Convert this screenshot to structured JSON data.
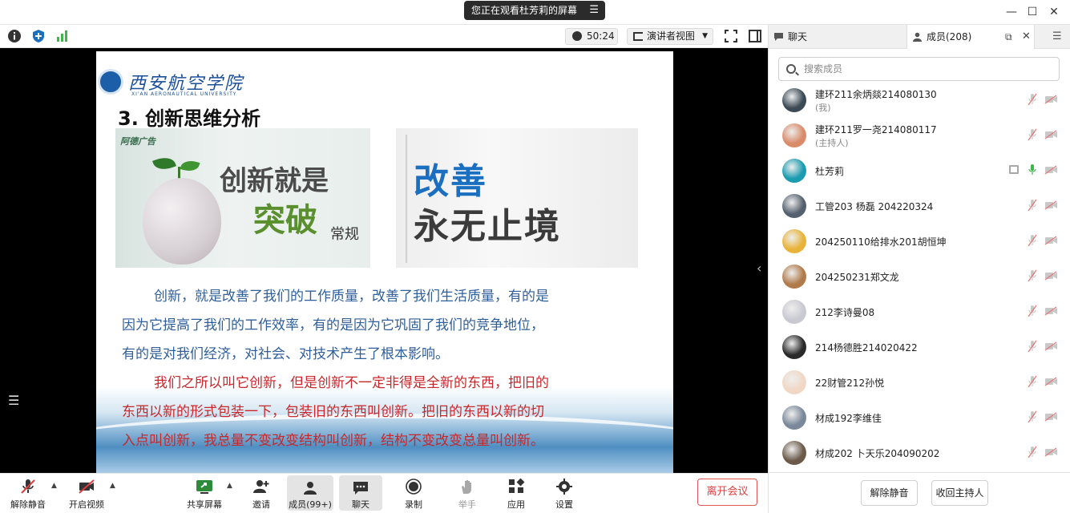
{
  "window": {
    "share_banner": "您正在观看杜芳莉的屏幕",
    "minimize": "—",
    "maximize": "☐",
    "close": "✕"
  },
  "toolbar": {
    "timer": "50:24",
    "view_mode": "演讲者视图"
  },
  "slide": {
    "logo_cn": "西安航空学院",
    "logo_en": "XI'AN AERONAUTICAL UNIVERSITY",
    "title": "3. 创新思维分析",
    "img_left_brand": "阿德广告",
    "img_left_t1": "创新就是",
    "img_left_t2": "突破",
    "img_left_t3": "常规",
    "img_right_line1": "改善",
    "img_right_line2": "永无止境",
    "para_blue": [
      "创新，就是改善了我们的工作质量，改善了我们生活质量，有的是",
      "因为它提高了我们的工作效率，有的是因为它巩固了我们的竞争地位，",
      "有的是对我们经济，对社会、对技术产生了根本影响。"
    ],
    "para_red": [
      "我们之所以叫它创新，但是创新不一定非得是全新的东西，把旧的",
      "东西以新的形式包装一下，包装旧的东西叫创新。把旧的东西以新的切",
      "入点叫创新，我总量不变改变结构叫创新，结构不变改变总量叫创新。"
    ]
  },
  "bottombar": {
    "unmute": "解除静音",
    "start_video": "开启视频",
    "share_screen": "共享屏幕",
    "invite": "邀请",
    "members": "成员(99+)",
    "chat": "聊天",
    "record": "录制",
    "raise_hand": "举手",
    "apps": "应用",
    "settings": "设置",
    "leave": "离开会议"
  },
  "panel": {
    "tab_chat": "聊天",
    "tab_members": "成员(208)",
    "search_placeholder": "搜索成员",
    "members": [
      {
        "name": "建环211余炳燚214080130",
        "role": "(我)",
        "avatar_color": "#3b4a55"
      },
      {
        "name": "建环211罗一尧214080117",
        "role": "(主持人)",
        "avatar_color": "#d98b6a"
      },
      {
        "name": "杜芳莉",
        "role": "",
        "avatar_color": "#1a9bb0"
      },
      {
        "name": "工管203  杨磊  204220324",
        "role": "",
        "avatar_color": "#55606e"
      },
      {
        "name": "204250110给排水201胡恒坤",
        "role": "",
        "avatar_color": "#e8b33a"
      },
      {
        "name": "204250231郑文龙",
        "role": "",
        "avatar_color": "#b07a4a"
      },
      {
        "name": "212李诗曼08",
        "role": "",
        "avatar_color": "#c9c9d2"
      },
      {
        "name": "214杨德胜214020422",
        "role": "",
        "avatar_color": "#2a2a2a"
      },
      {
        "name": "22财管212孙悦",
        "role": "",
        "avatar_color": "#f1d7c5"
      },
      {
        "name": "材成192李维佳",
        "role": "",
        "avatar_color": "#7a8899"
      },
      {
        "name": "材成202  卜天乐204090202",
        "role": "",
        "avatar_color": "#6b5a4a"
      }
    ],
    "unmute_all": "解除静音",
    "reclaim_host": "收回主持人"
  },
  "colors": {
    "accent": "#1b6fc0",
    "leave_red": "#e03c3c",
    "muted_gray": "#c8c8c8",
    "active_mic_green": "#3fb54a"
  }
}
